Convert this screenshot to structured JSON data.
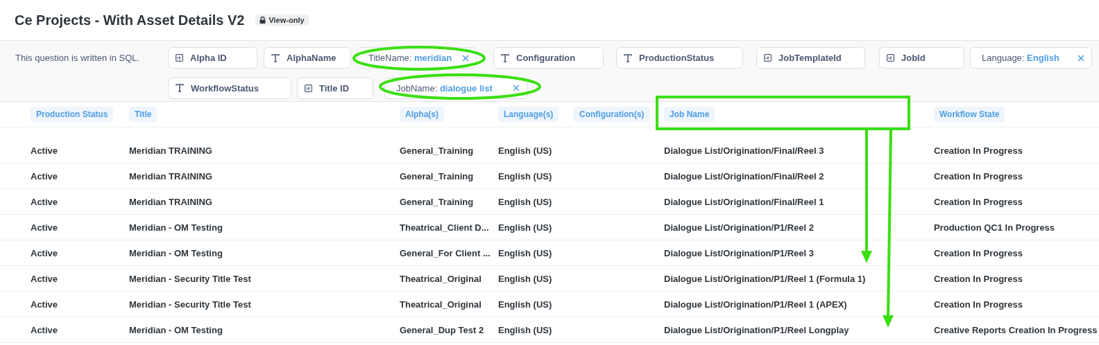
{
  "header": {
    "title": "Ce Projects - With Asset Details V2",
    "badge": "View-only"
  },
  "filter_bar": {
    "note": "This question is written in SQL.",
    "filters": [
      {
        "kind": "number",
        "label": "Alpha ID"
      },
      {
        "kind": "text",
        "label": "AlphaName"
      },
      {
        "kind": "value",
        "label": "TitleName:",
        "value": "meridian"
      },
      {
        "kind": "text",
        "label": "Configuration"
      },
      {
        "kind": "text",
        "label": "ProductionStatus"
      },
      {
        "kind": "number",
        "label": "JobTemplateId"
      },
      {
        "kind": "number",
        "label": "JobId"
      },
      {
        "kind": "value",
        "label": "Language:",
        "value": "English"
      },
      {
        "kind": "text",
        "label": "WorkflowStatus"
      },
      {
        "kind": "number",
        "label": "Title ID"
      },
      {
        "kind": "value",
        "label": "JobName:",
        "value": "dialogue list"
      }
    ]
  },
  "table": {
    "columns": [
      "Production Status",
      "Title",
      "Alpha(s)",
      "Language(s)",
      "Configuration(s)",
      "Job Name",
      "Workflow State"
    ],
    "rows": [
      [
        "Active",
        "Meridian TRAINING",
        "General_Training",
        "English (US)",
        "",
        "Dialogue List/Origination/Final/Reel 3",
        "Creation In Progress"
      ],
      [
        "Active",
        "Meridian TRAINING",
        "General_Training",
        "English (US)",
        "",
        "Dialogue List/Origination/Final/Reel 2",
        "Creation In Progress"
      ],
      [
        "Active",
        "Meridian TRAINING",
        "General_Training",
        "English (US)",
        "",
        "Dialogue List/Origination/Final/Reel 1",
        "Creation In Progress"
      ],
      [
        "Active",
        "Meridian - OM Testing",
        "Theatrical_Client D...",
        "English (US)",
        "",
        "Dialogue List/Origination/P1/Reel 2",
        "Production QC1 In Progress"
      ],
      [
        "Active",
        "Meridian - OM Testing",
        "General_For Client ...",
        "English (US)",
        "",
        "Dialogue List/Origination/P1/Reel 3",
        "Creation In Progress"
      ],
      [
        "Active",
        "Meridian - Security Title Test",
        "Theatrical_Original",
        "English (US)",
        "",
        "Dialogue List/Origination/P1/Reel 1 (Formula 1)",
        "Creation In Progress"
      ],
      [
        "Active",
        "Meridian - Security Title Test",
        "Theatrical_Original",
        "English (US)",
        "",
        "Dialogue List/Origination/P1/Reel 1 (APEX)",
        "Creation In Progress"
      ],
      [
        "Active",
        "Meridian - OM Testing",
        "General_Dup Test 2",
        "English (US)",
        "",
        "Dialogue List/Origination/P1/Reel Longplay",
        "Creative Reports Creation In Progress"
      ]
    ]
  }
}
